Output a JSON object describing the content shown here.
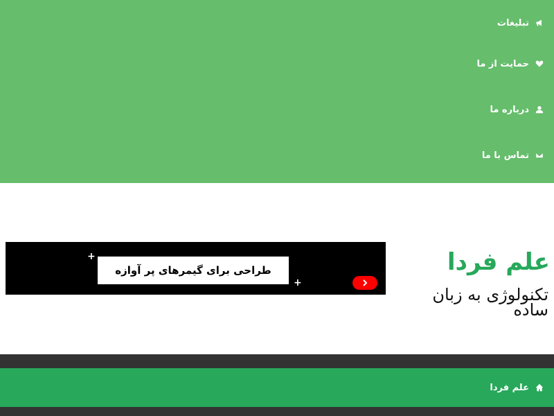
{
  "top_nav": {
    "items": [
      {
        "label": "تبلیغات",
        "icon": "megaphone-icon"
      },
      {
        "label": "حمایت از ما",
        "icon": "heart-icon"
      },
      {
        "label": "درباره ما",
        "icon": "user-icon"
      },
      {
        "label": "تماس با ما",
        "icon": "envelope-icon"
      }
    ]
  },
  "header": {
    "site_title": "علم فردا",
    "tagline": "تکنولوژی به زبان ساده"
  },
  "ad": {
    "text": "طراحی برای گیمرهای پر آوازه",
    "play_icon": "play-arrow-icon"
  },
  "bottom_nav": {
    "home_label": "علم فردا",
    "home_icon": "home-icon"
  },
  "colors": {
    "top_nav_bg": "#66bd6c",
    "brand_green": "#27a85b",
    "dark_bar": "#333333",
    "ad_bg": "#000000",
    "ad_play": "#ff0000"
  }
}
